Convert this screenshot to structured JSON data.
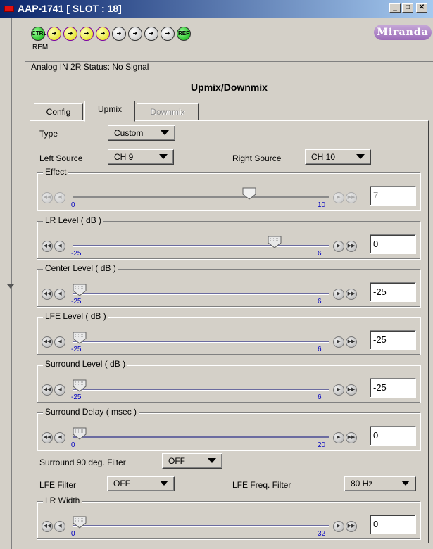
{
  "window": {
    "title": "AAP-1741 [ SLOT : 18]"
  },
  "header": {
    "leds": [
      "CTRL",
      "",
      "",
      "",
      "",
      "",
      "",
      "",
      "",
      "REF"
    ],
    "rem_label": "REM",
    "logo_text": "Miranda"
  },
  "status_text": "Analog IN 2R Status: No Signal",
  "page_title": "Upmix/Downmix",
  "tabs": [
    {
      "label": "Config"
    },
    {
      "label": "Upmix"
    },
    {
      "label": "Downmix"
    }
  ],
  "controls": {
    "type_label": "Type",
    "type_value": "Custom",
    "left_source_label": "Left Source",
    "left_source_value": "CH 9",
    "right_source_label": "Right Source",
    "right_source_value": "CH 10"
  },
  "sliders": [
    {
      "title": "Effect",
      "min_label": "0",
      "max_label": "10",
      "value": "7",
      "level": 0.7,
      "enabled": false
    },
    {
      "title": "LR Level ( dB )",
      "min_label": "-25",
      "max_label": "6",
      "value": "0",
      "level": 0.806,
      "enabled": true
    },
    {
      "title": "Center Level ( dB )",
      "min_label": "-25",
      "max_label": "6",
      "value": "-25",
      "level": 0,
      "enabled": true
    },
    {
      "title": "LFE Level ( dB )",
      "min_label": "-25",
      "max_label": "6",
      "value": "-25",
      "level": 0,
      "enabled": true
    },
    {
      "title": "Surround Level ( dB )",
      "min_label": "-25",
      "max_label": "6",
      "value": "-25",
      "level": 0,
      "enabled": true
    },
    {
      "title": "Surround Delay ( msec )",
      "min_label": "0",
      "max_label": "20",
      "value": "0",
      "level": 0,
      "enabled": true
    },
    {
      "title": "LR Width",
      "min_label": "0",
      "max_label": "32",
      "value": "0",
      "level": 0,
      "enabled": true
    }
  ],
  "filters": {
    "surround_filter_label": "Surround 90 deg. Filter",
    "surround_filter_value": "OFF",
    "lfe_filter_label": "LFE Filter",
    "lfe_filter_value": "OFF",
    "lfe_freq_label": "LFE Freq. Filter",
    "lfe_freq_value": "80 Hz"
  },
  "colors": {
    "title_bar": "#0a246a",
    "tick_labels": "#0000c0",
    "led_border": "#7a00a0"
  }
}
